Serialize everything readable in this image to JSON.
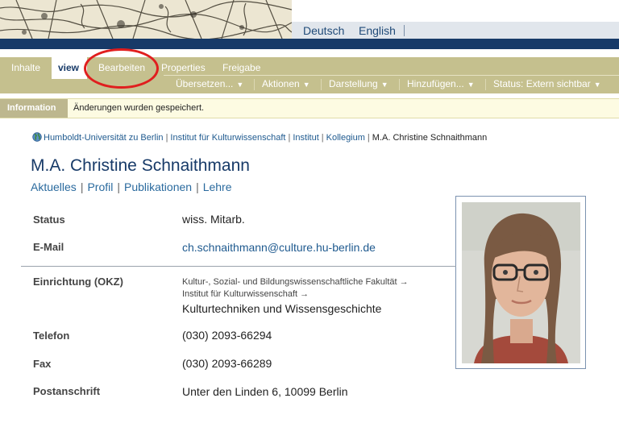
{
  "header": {
    "languages": [
      "Deutsch",
      "English"
    ]
  },
  "editbar": {
    "tabs": [
      "Inhalte",
      "view",
      "Bearbeiten",
      "Properties",
      "Freigabe"
    ],
    "menus": [
      "Übersetzen...",
      "Aktionen",
      "Darstellung",
      "Hinzufügen...",
      "Status: Extern sichtbar"
    ],
    "highlight_color": "#e01e1e"
  },
  "info": {
    "label": "Information",
    "message": "Änderungen wurden gespeichert."
  },
  "breadcrumb": [
    "Humboldt-Universität zu Berlin",
    "Institut für Kulturwissenschaft",
    "Institut",
    "Kollegium",
    "M.A. Christine Schnaithmann"
  ],
  "page": {
    "title": "M.A. Christine Schnaithmann",
    "subnav": [
      "Aktuelles",
      "Profil",
      "Publikationen",
      "Lehre"
    ]
  },
  "profile": {
    "status_label": "Status",
    "status_value": "wiss. Mitarb.",
    "email_label": "E-Mail",
    "email_value": "ch.schnaithmann@culture.hu-berlin.de",
    "okz_label": "Einrichtung (OKZ)",
    "okz_line1": "Kultur-, Sozial- und Bildungswissenschaftliche Fakultät →",
    "okz_line2": "Institut für Kulturwissenschaft →",
    "okz_line3": "Kulturtechniken und Wissensgeschichte",
    "phone_label": "Telefon",
    "phone_value": "(030) 2093-66294",
    "fax_label": "Fax",
    "fax_value": "(030) 2093-66289",
    "address_label": "Postanschrift",
    "address_value": "Unter den Linden 6, 10099 Berlin"
  }
}
